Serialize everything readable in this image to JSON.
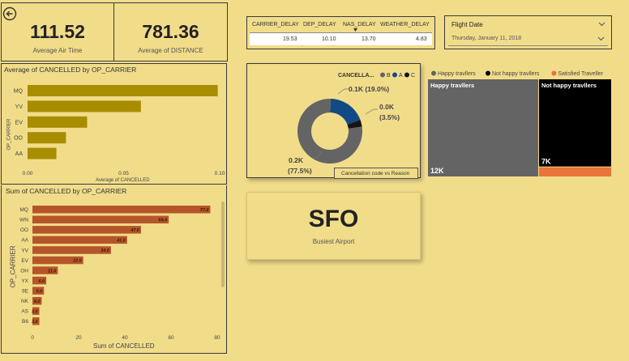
{
  "kpis": [
    {
      "value": "111.52",
      "label": "Average Air Time"
    },
    {
      "value": "781.36",
      "label": "Average of DISTANCE"
    }
  ],
  "delay_table": {
    "headers": [
      "CARRIER_DELAY",
      "DEP_DELAY",
      "NAS_DELAY",
      "WEATHER_DELAY"
    ],
    "values": [
      "19.53",
      "10.10",
      "13.70",
      "4.83"
    ]
  },
  "slicer": {
    "label": "Flight Date",
    "value": "Thursday, January 11, 2018"
  },
  "busiest_airport": {
    "value": "SFO",
    "label": "Busiest Airport"
  },
  "donut_tooltip": "Cancellation code vs Reason",
  "colors": {
    "background": "#f1dc8a",
    "bar_gold": "#a98d00",
    "bar_rust": "#b5562a",
    "donut_b": "#646464",
    "donut_a": "#124a86",
    "donut_c": "#151515",
    "happy": "#646464",
    "not_happy": "#000000",
    "satisfied": "#e8743b"
  },
  "chart_data": [
    {
      "type": "bar",
      "title": "Average of CANCELLED by OP_CARRIER",
      "xlabel": "Average of CANCELLED",
      "ylabel": "OP_CARRIER",
      "categories": [
        "MQ",
        "YV",
        "EV",
        "OO",
        "AA"
      ],
      "values": [
        0.099,
        0.059,
        0.031,
        0.02,
        0.015
      ],
      "xlim": [
        0,
        0.1
      ],
      "ticks": [
        "0.00",
        "0.05",
        "0.10"
      ]
    },
    {
      "type": "bar",
      "title": "Sum of CANCELLED by OP_CARRIER",
      "xlabel": "Sum of CANCELLED",
      "ylabel": "OP_CARRIER",
      "categories": [
        "MQ",
        "WN",
        "OO",
        "AA",
        "YV",
        "EV",
        "OH",
        "YX",
        "9E",
        "NK",
        "AS",
        "B6"
      ],
      "values": [
        77.0,
        59.0,
        47.0,
        41.0,
        34.0,
        22.0,
        11.0,
        6.0,
        5.0,
        4.0,
        3.0,
        3.0
      ],
      "labels": [
        "77.0",
        "59.0",
        "47.0",
        "41.0",
        "34.0",
        "22.0",
        "11.0",
        "6.0",
        "5.0",
        "4.0",
        "3.0",
        "3.0"
      ],
      "xlim": [
        0,
        80
      ],
      "ticks": [
        "0",
        "20",
        "40",
        "60",
        "80"
      ]
    },
    {
      "type": "pie",
      "title": "CANCELLA...",
      "legend": [
        "B",
        "A",
        "C"
      ],
      "values": [
        0.2,
        0.1,
        0.0
      ],
      "percents": [
        77.5,
        19.0,
        3.5
      ],
      "labels": [
        "0.2K",
        "0.1K (19.0%)",
        "0.0K"
      ],
      "pct_labels": [
        "(77.5%)",
        "(3.5%)"
      ]
    },
    {
      "type": "heatmap",
      "legend": [
        "Happy travllers",
        "Not happy travllers",
        "Satisfied Traveller"
      ],
      "tiles": [
        {
          "name": "Happy travllers",
          "label": "12K",
          "value": 12000
        },
        {
          "name": "Not happy travllers",
          "label": "7K",
          "value": 7000
        },
        {
          "name": "Satisfied Traveller",
          "label": "",
          "value": 800
        }
      ]
    }
  ]
}
